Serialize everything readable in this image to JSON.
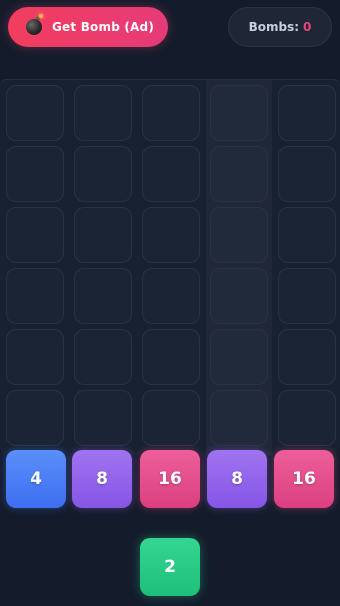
{
  "header": {
    "get_bomb_label": "Get Bomb (Ad)",
    "bombs_label": "Bombs:",
    "bombs_count": "0"
  },
  "board": {
    "columns": 5,
    "rows": 6,
    "highlighted_column": 3,
    "bottom_tiles": [
      {
        "value": "4",
        "color": "blue"
      },
      {
        "value": "8",
        "color": "purple"
      },
      {
        "value": "16",
        "color": "pink"
      },
      {
        "value": "8",
        "color": "purple"
      },
      {
        "value": "16",
        "color": "pink"
      }
    ]
  },
  "next_tile": {
    "value": "2",
    "color": "green"
  },
  "colors": {
    "background": "#141c2b",
    "accent_pink": "#e8457a",
    "blue": "#3d6ef0",
    "purple": "#8656e6",
    "pink": "#dd3f80",
    "green": "#1fbf7a"
  }
}
